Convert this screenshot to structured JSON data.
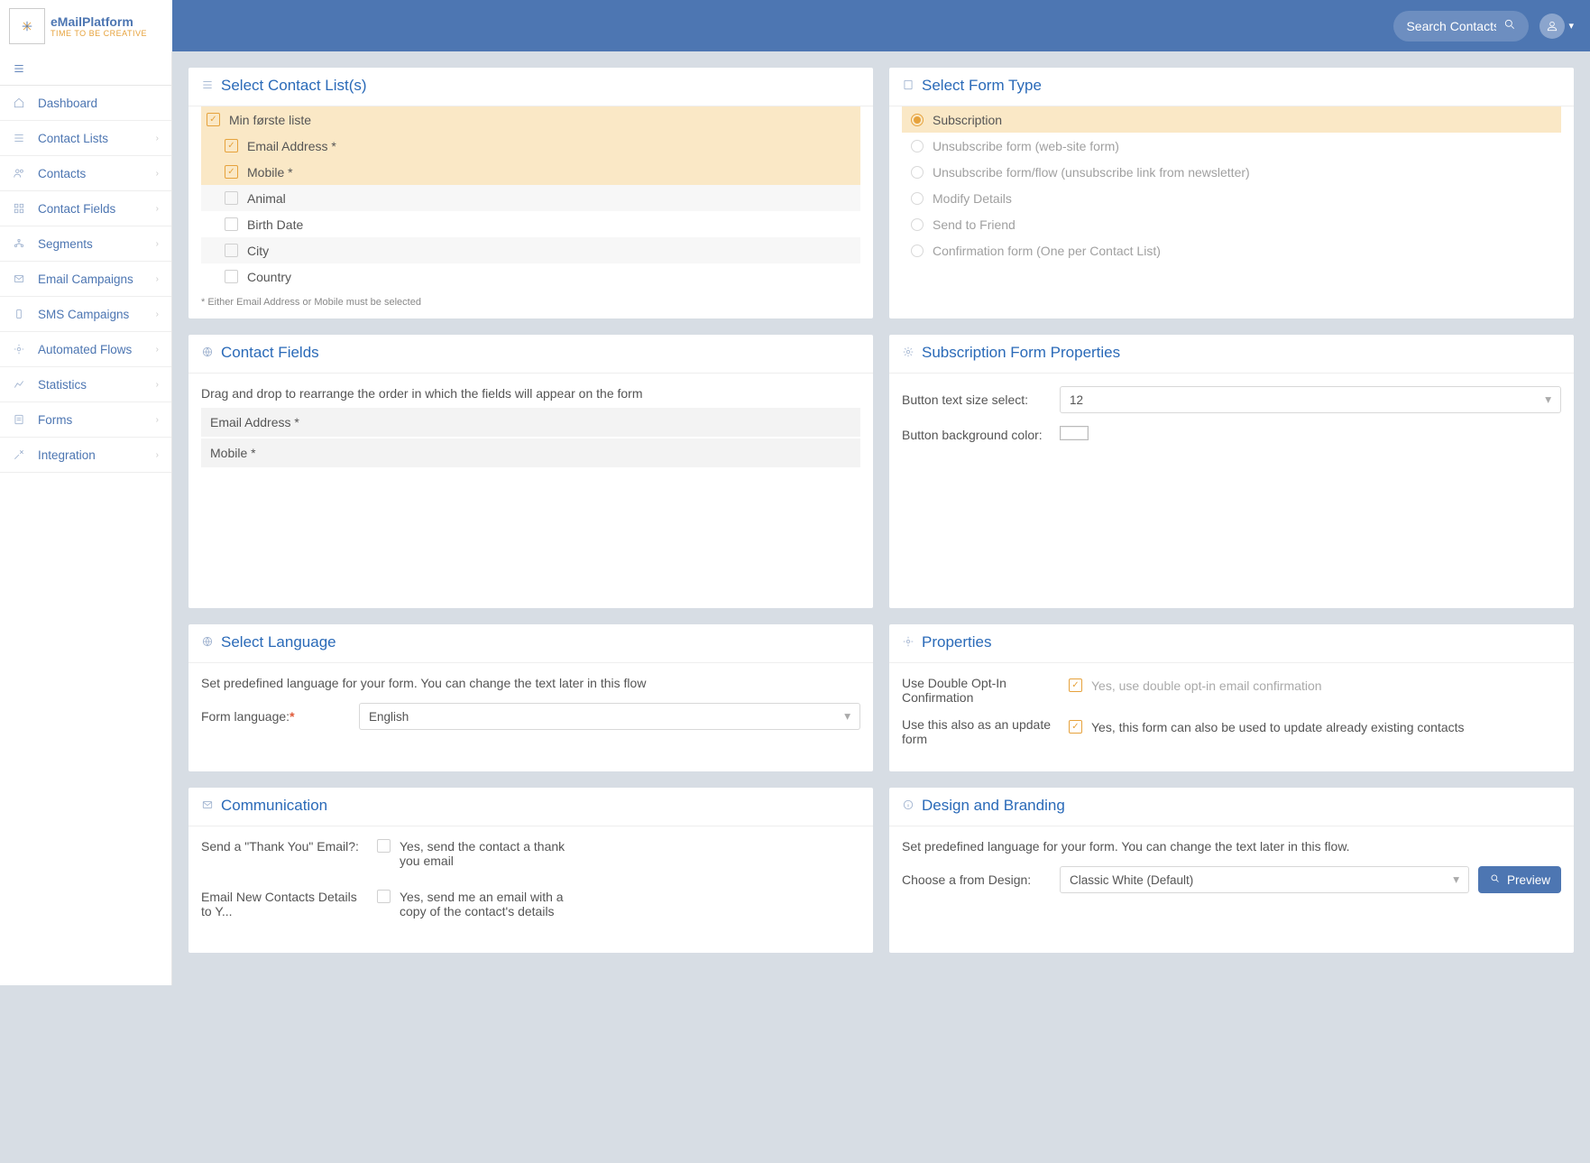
{
  "brand": {
    "name": "eMailPlatform",
    "tagline": "TIME TO BE CREATIVE"
  },
  "search": {
    "placeholder": "Search Contacts"
  },
  "nav": [
    {
      "label": "Dashboard",
      "has_children": false
    },
    {
      "label": "Contact Lists",
      "has_children": true
    },
    {
      "label": "Contacts",
      "has_children": true
    },
    {
      "label": "Contact Fields",
      "has_children": true
    },
    {
      "label": "Segments",
      "has_children": true
    },
    {
      "label": "Email Campaigns",
      "has_children": true
    },
    {
      "label": "SMS Campaigns",
      "has_children": true
    },
    {
      "label": "Automated Flows",
      "has_children": true
    },
    {
      "label": "Statistics",
      "has_children": true
    },
    {
      "label": "Forms",
      "has_children": true
    },
    {
      "label": "Integration",
      "has_children": true
    }
  ],
  "contact_list_panel": {
    "title": "Select Contact List(s)",
    "items": [
      {
        "label": "Min første liste",
        "checked": true,
        "highlight": true,
        "indent": false
      },
      {
        "label": "Email Address *",
        "checked": true,
        "highlight": true,
        "indent": true
      },
      {
        "label": "Mobile *",
        "checked": true,
        "highlight": true,
        "indent": true
      },
      {
        "label": "Animal",
        "checked": false,
        "highlight": false,
        "indent": true,
        "alt": true
      },
      {
        "label": "Birth Date",
        "checked": false,
        "highlight": false,
        "indent": true
      },
      {
        "label": "City",
        "checked": false,
        "highlight": false,
        "indent": true,
        "alt": true
      },
      {
        "label": "Country",
        "checked": false,
        "highlight": false,
        "indent": true
      }
    ],
    "footnote": "* Either Email Address or Mobile must be selected"
  },
  "form_type_panel": {
    "title": "Select Form Type",
    "items": [
      {
        "label": "Subscription",
        "selected": true,
        "highlight": true
      },
      {
        "label": "Unsubscribe form (web-site form)",
        "selected": false
      },
      {
        "label": "Unsubscribe form/flow (unsubscribe link from newsletter)",
        "selected": false
      },
      {
        "label": "Modify Details",
        "selected": false
      },
      {
        "label": "Send to Friend",
        "selected": false
      },
      {
        "label": "Confirmation form (One per Contact List)",
        "selected": false
      }
    ]
  },
  "contact_fields_panel": {
    "title": "Contact Fields",
    "hint": "Drag and drop to rearrange the order in which the fields will appear on the form",
    "fields": [
      "Email Address *",
      "Mobile *"
    ]
  },
  "sub_props_panel": {
    "title": "Subscription Form Properties",
    "size_label": "Button text size select:",
    "size_value": "12",
    "color_label": "Button background color:"
  },
  "language_panel": {
    "title": "Select Language",
    "hint": "Set predefined language for your form. You can change the text later in this flow",
    "field_label": "Form language:",
    "value": "English"
  },
  "props_panel": {
    "title": "Properties",
    "rows": [
      {
        "k": "Use Double Opt-In Confirmation",
        "v": "Yes, use double opt-in email confirmation",
        "checked": true,
        "disabled_text": true
      },
      {
        "k": "Use this also as an update form",
        "v": "Yes, this form can also be used to update already existing contacts",
        "checked": true,
        "disabled_text": false
      }
    ]
  },
  "comm_panel": {
    "title": "Communication",
    "rows": [
      {
        "k": "Send a \"Thank You\" Email?:",
        "v": "Yes, send the contact a thank you email"
      },
      {
        "k": "Email New Contacts Details to Y...",
        "v": "Yes, send me an email with a copy of the contact's details"
      }
    ]
  },
  "design_panel": {
    "title": "Design and Branding",
    "hint": "Set predefined language for your form. You can change the text later in this flow.",
    "field_label": "Choose a from Design:",
    "value": "Classic White (Default)",
    "preview_label": "Preview"
  }
}
